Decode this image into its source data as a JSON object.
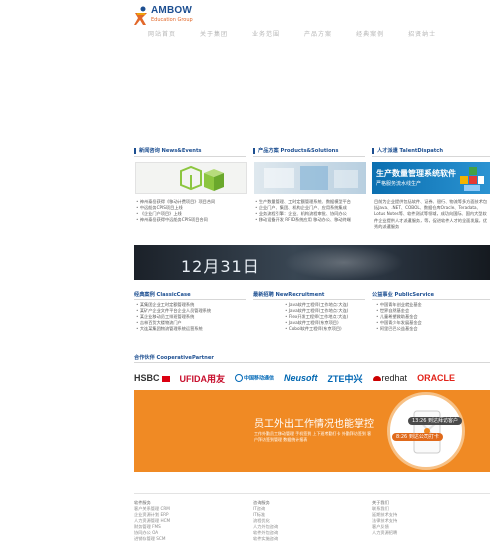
{
  "logo": {
    "name": "AMBOW",
    "sub": "Education Group"
  },
  "nav": [
    "网站首页",
    "关于集团",
    "业务范围",
    "产品方案",
    "经典案例",
    "招贤纳士"
  ],
  "news": {
    "heading": "新闻咨询 News&Events",
    "items": [
      "神州泰岳获得《移动计费项目》项目合同",
      "中远船务CPIS项目上线",
      "《企业门户项目》上线",
      "神州泰岳获得中远船务CPIS项目合同"
    ]
  },
  "products": {
    "heading": "产品方案 Products&Solutions",
    "items": [
      "生产数量管理、工时定额管理系统、数据模型平台",
      "企业门户、集团、机构企业门户、应用系统集成",
      "业务流程引擎：企业、机构流程审批、协同办公",
      "移动设备开发 RFID系统应用 移动办公、移动终端"
    ]
  },
  "talent": {
    "heading": "人才派遣 TalentDispatch",
    "img_title": "生产数量管理系统软件",
    "img_sub": "严格服务流水线生产",
    "text": "目前为企业提供包括软件、证券、银行、物流等多方面技术包括Java、.NET、COBOL、数据仓库Oracle、Teradata、Lotus Notes等、软件测试等领域，成功向国际、国内大型软件企业提供人才派遣服务，等，促进软件人才的全面发展，优秀的派遣服务"
  },
  "banner": {
    "date": "12月31日"
  },
  "cases": {
    "heading": "经典案例 ClassicCase",
    "items": [
      "某集团企业工时定额管理系统",
      "某矿产企业文件平台企业人员管理系统",
      "某企业移动员工排班管理系统",
      "吉林百货大楼物流门户",
      "大连某集团物流管理系统运营系统"
    ]
  },
  "recruit": {
    "heading": "最新招聘 NewRecruitment",
    "items": [
      "Java软件工程师(工作地点:大连)",
      "Java软件工程师(工作地点:大连)",
      "Flex开发工程师(工作地点:大连)",
      "Java软件工程师(东京项目)",
      "Cobol软件工程师(东京项目)"
    ]
  },
  "public": {
    "heading": "公益事业 PublicService",
    "items": [
      "中国青年创业就业基金",
      "世界自然基金会",
      "儿童希望救助基金会",
      "中国青少年发展基金会",
      "阿里巴巴公益基金会"
    ]
  },
  "partners": {
    "heading": "合作伙伴 CooperativePartner",
    "names": [
      "HSBC",
      "UFIDA用友",
      "中国移动通信",
      "Neusoft",
      "ZTE中兴",
      "redhat",
      "ORACLE"
    ]
  },
  "promo": {
    "title": "员工外出工作情况也能掌控",
    "sub": "工作外勤员工移动管理 手机签到 上下班考勤打卡 外勤拜访签到 客户拜访签到管理 数据统计报表",
    "chip1": "13:26 到达拜访客户",
    "chip2": "8:26 到达公司打卡"
  },
  "footer": {
    "col1": {
      "head": "软件服务",
      "items": [
        "客户关系管理 CRM",
        "企业资源计划 ERP",
        "人力资源管理 HCM",
        "财务管理 FMS",
        "协同办公 OA",
        "进销存管理 SCM"
      ]
    },
    "col2": {
      "head": "咨询服务",
      "items": [
        "IT咨询",
        "IT标准",
        "流程优化",
        "人力外包咨询",
        "软件外包咨询",
        "软件实施咨询"
      ]
    },
    "col3": {
      "head": "关于我们",
      "items": [
        "联系我们",
        "延期技术支持",
        "法律技术支持",
        "客户反馈",
        "人力资源招聘"
      ]
    }
  },
  "colors": {
    "brand": "#1d4f91",
    "accent": "#f08a24"
  }
}
